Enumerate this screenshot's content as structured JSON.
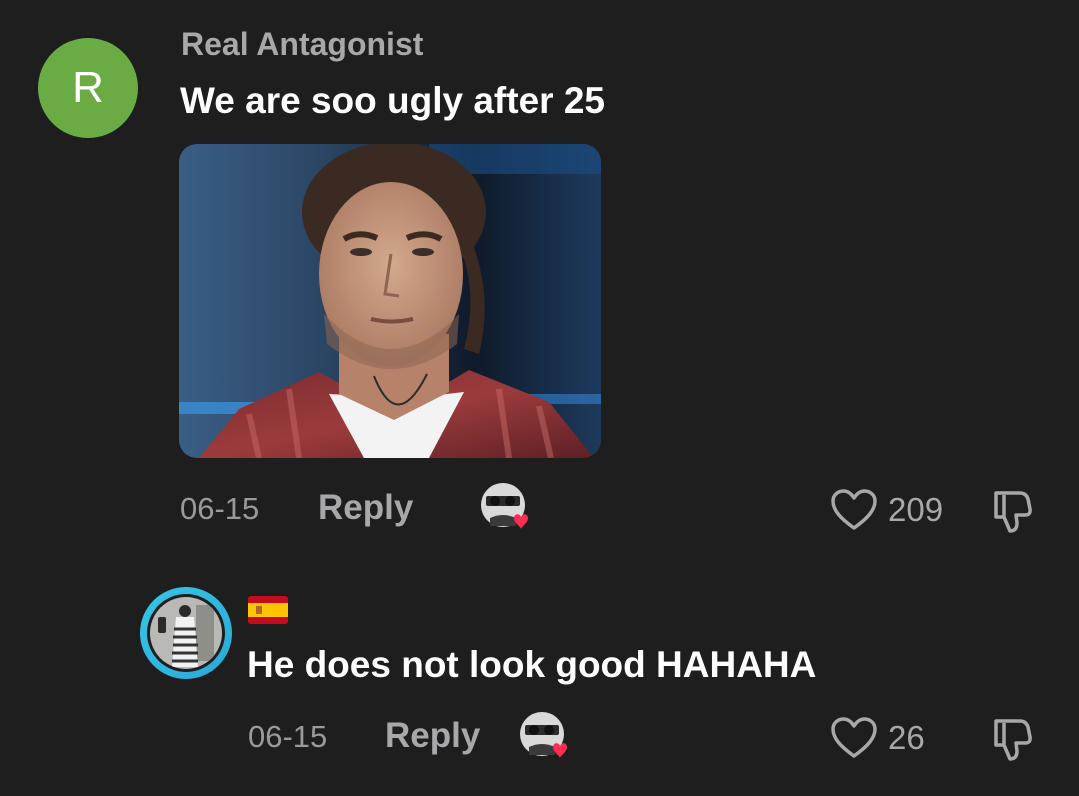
{
  "comment": {
    "avatar_letter": "R",
    "username": "Real Antagonist",
    "text": "We are soo ugly after 25",
    "date": "06-15",
    "reply_label": "Reply",
    "like_count": "209"
  },
  "reply_comment": {
    "flag": "spain-flag",
    "text": "He does not look good HAHAHA",
    "date": "06-15",
    "reply_label": "Reply",
    "like_count": "26"
  },
  "colors": {
    "background": "#1e1e1f",
    "avatar_green": "#6aac43",
    "ring_blue": "#35c6e6",
    "creator_heart": "#fe2c55"
  },
  "icons": [
    "heart-outline-icon",
    "dislike-icon",
    "creator-liked-badge-icon"
  ]
}
